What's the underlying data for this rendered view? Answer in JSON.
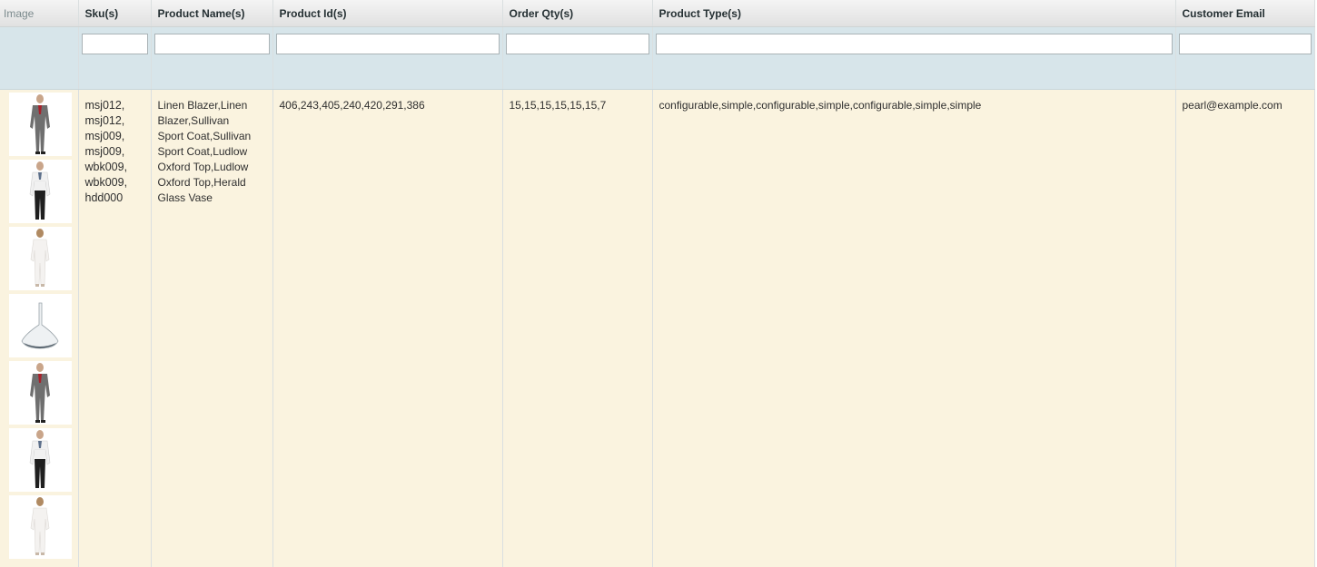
{
  "columns": {
    "image": "Image",
    "sku": "Sku(s)",
    "name": "Product Name(s)",
    "product_id": "Product Id(s)",
    "order_qty": "Order Qty(s)",
    "product_type": "Product Type(s)",
    "customer_email": "Customer Email"
  },
  "filters": {
    "sku": "",
    "name": "",
    "product_id": "",
    "order_qty": "",
    "product_type": "",
    "customer_email": ""
  },
  "row": {
    "images": [
      "grey-suit-red-shirt-image",
      "white-blazer-black-pants-image",
      "white-outfit-image",
      "glass-vase-image",
      "grey-suit-red-shirt-image",
      "white-blazer-black-pants-image",
      "white-outfit-image"
    ],
    "sku_lines": [
      "msj012,",
      "msj012,",
      "msj009,",
      "msj009,",
      "wbk009,",
      "wbk009,",
      "hdd000"
    ],
    "name_lines": [
      "Linen Blazer,Linen",
      "Blazer,Sullivan",
      "Sport Coat,Sullivan",
      "Sport Coat,Ludlow",
      "Oxford Top,Ludlow",
      "Oxford Top,Herald",
      "Glass Vase"
    ],
    "product_ids": "406,243,405,240,420,291,386",
    "order_qtys": "15,15,15,15,15,15,7",
    "product_types": "configurable,simple,configurable,simple,configurable,simple,simple",
    "customer_email": "pearl@example.com"
  },
  "colors": {
    "header_bg": "#e6e6e6",
    "filter_bg": "#d7e5ea",
    "row_bg": "#faf3df",
    "suit_grey": "#6f6f6f",
    "shirt_red": "#a8202a"
  }
}
